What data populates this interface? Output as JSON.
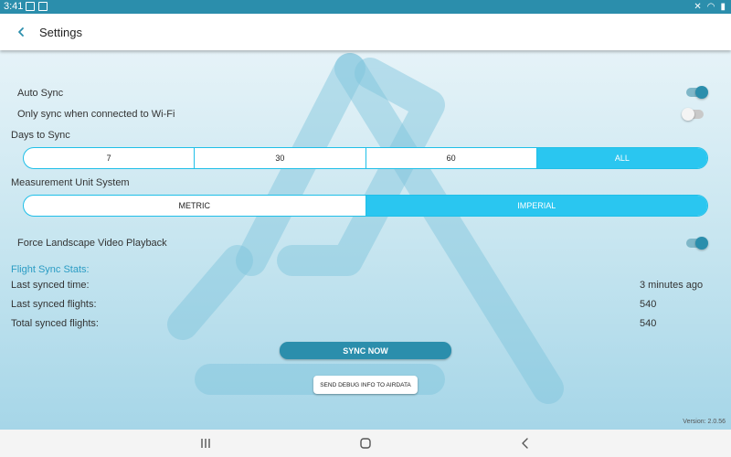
{
  "status_bar": {
    "time": "3:41"
  },
  "header": {
    "title": "Settings"
  },
  "settings": {
    "auto_sync": {
      "label": "Auto Sync",
      "enabled": true
    },
    "wifi_only": {
      "label": "Only sync when connected to Wi-Fi",
      "enabled": false
    },
    "days_to_sync": {
      "label": "Days to Sync",
      "options": [
        "7",
        "30",
        "60",
        "ALL"
      ],
      "selected": "ALL"
    },
    "unit_system": {
      "label": "Measurement Unit System",
      "options": [
        "METRIC",
        "IMPERIAL"
      ],
      "selected": "IMPERIAL"
    },
    "force_landscape": {
      "label": "Force Landscape Video Playback",
      "enabled": true
    }
  },
  "stats": {
    "title": "Flight Sync Stats:",
    "rows": [
      {
        "label": "Last synced time:",
        "value": "3 minutes ago"
      },
      {
        "label": "Last synced flights:",
        "value": "540"
      },
      {
        "label": "Total synced flights:",
        "value": "540"
      }
    ]
  },
  "buttons": {
    "sync_now": "SYNC NOW",
    "send_debug": "SEND DEBUG INFO TO AIRDATA"
  },
  "version": "Version: 2.0.56",
  "colors": {
    "accent": "#2b8eac",
    "segment_selected": "#2ac6f0",
    "stats_title": "#2b9cc4"
  }
}
